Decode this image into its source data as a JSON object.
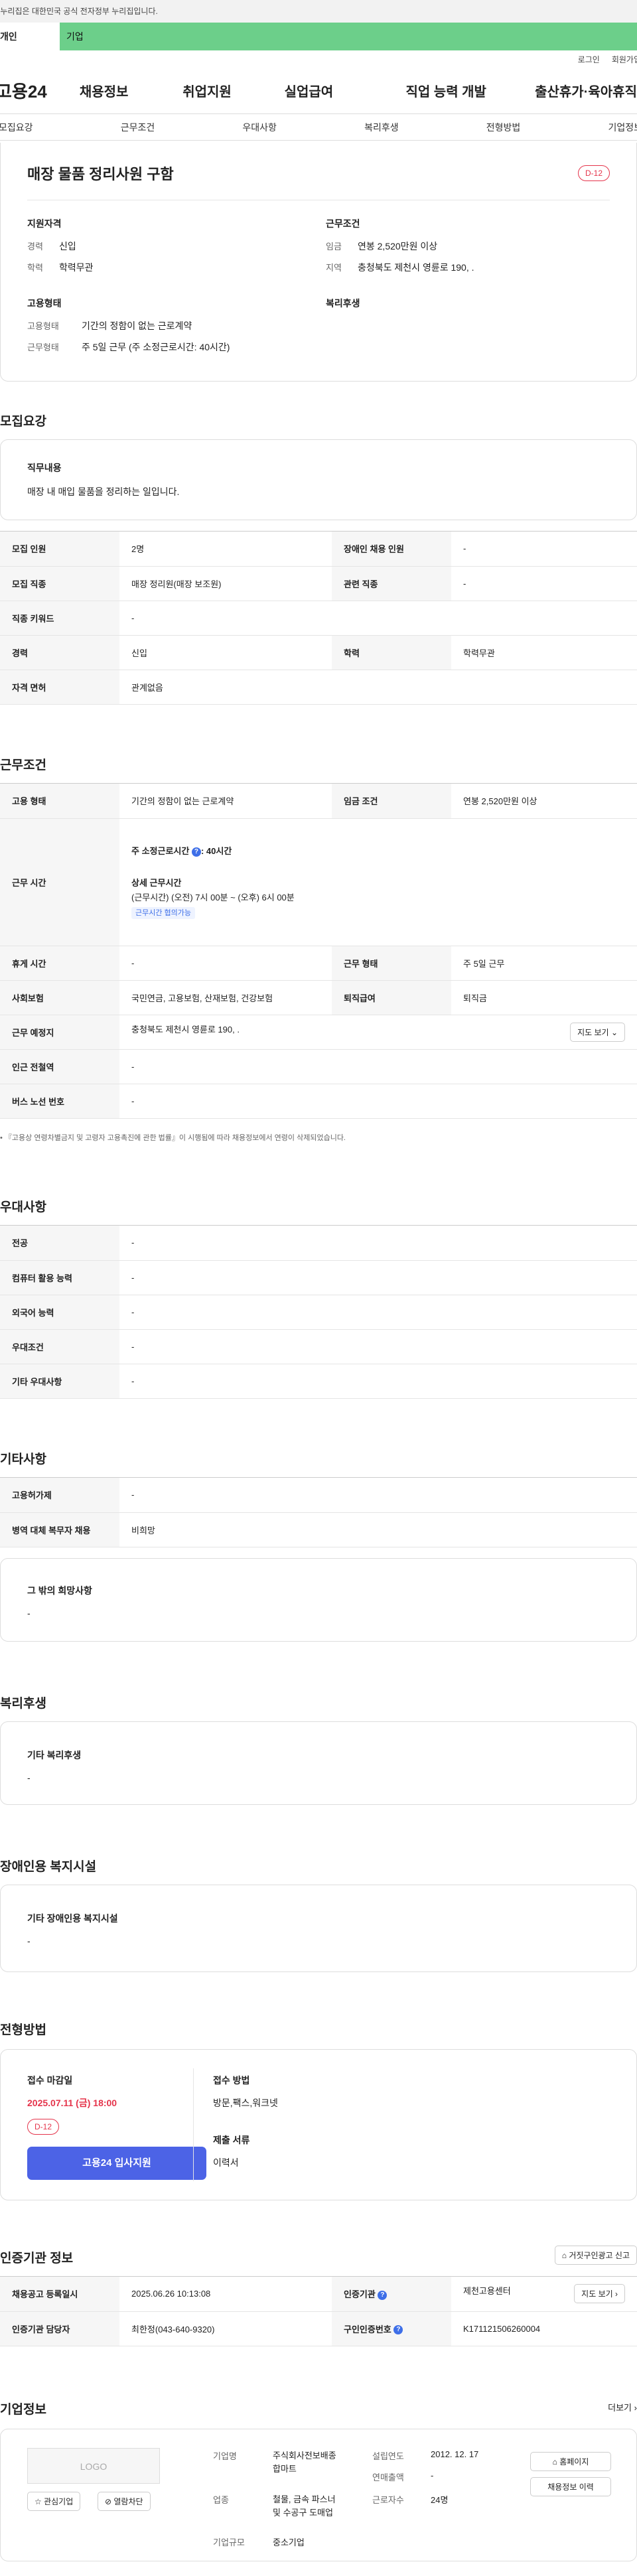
{
  "gov_banner": "이 누리집은 대한민국 공식 전자정부 누리집입니다.",
  "top_tabs": [
    "개인",
    "기업"
  ],
  "util": [
    "로그인",
    "회원가입"
  ],
  "logo": "고용24",
  "gnb": [
    "채용정보",
    "취업지원",
    "실업급여",
    "직업 능력 개발",
    "출산휴가·육아휴직"
  ],
  "subnav": [
    "모집요강",
    "근무조건",
    "우대사항",
    "복리후생",
    "전형방법",
    "기업정보"
  ],
  "summary": {
    "title": "매장 물품 정리사원 구함",
    "dday": "D-12",
    "qual_label": "지원자격",
    "cond_label": "근무조건",
    "career_k": "경력",
    "career_v": "신입",
    "edu_k": "학력",
    "edu_v": "학력무관",
    "wage_k": "임금",
    "wage_v": "연봉 2,520만원 이상",
    "region_k": "지역",
    "region_v": "충청북도 제천시 영륜로 190, .",
    "emp_label": "고용형태",
    "welfare_label": "복리후생",
    "empform_k": "고용형태",
    "empform_v": "기간의 정함이 없는 근로계약",
    "worktype_k": "근무형태",
    "worktype_v": "주 5일 근무 (주 소정근로시간: 40시간)"
  },
  "recruit": {
    "title": "모집요강",
    "job_label": "직무내용",
    "job_text": "매장 내 매입 물품을 정리하는 일입니다.",
    "rows": [
      [
        "모집 인원",
        "2명",
        "장애인 채용 인원",
        "-"
      ],
      [
        "모집 직종",
        "매장 정리원(매장 보조원)",
        "관련 직종",
        "-"
      ],
      [
        "직종 키워드",
        "-"
      ],
      [
        "경력",
        "신입",
        "학력",
        "학력무관"
      ],
      [
        "자격 면허",
        "관계없음"
      ]
    ]
  },
  "work": {
    "title": "근무조건",
    "emp_k": "고용 형태",
    "emp_v": "기간의 정함이 없는 근로계약",
    "wage_k": "임금 조건",
    "wage_v": "연봉 2,520만원 이상",
    "hours_k": "근무 시간",
    "hours_total": "주 소정근로시간",
    "hours_total_v": ": 40시간",
    "hours_detail_label": "상세 근무시간",
    "hours_detail": "(근무시간) (오전) 7시 00분 ~ (오후) 6시 00분",
    "hours_badge": "근무시간 협의가능",
    "rows": [
      [
        "휴게 시간",
        "-",
        "근무 형태",
        "주 5일 근무"
      ],
      [
        "사회보험",
        "국민연금, 고용보험, 산재보험, 건강보험",
        "퇴직급여",
        "퇴직금"
      ]
    ],
    "place_k": "근무 예정지",
    "place_v": "충청북도 제천시 영륜로 190, .",
    "map_btn": "지도 보기",
    "station_k": "인근 전철역",
    "station_v": "-",
    "bus_k": "버스 노선 번호",
    "bus_v": "-",
    "note": "『고용상 연령차별금지 및 고령자 고용촉진에 관한 법률』이 시행됨에 따라 채용정보에서 연령이 삭제되었습니다."
  },
  "pref": {
    "title": "우대사항",
    "rows": [
      [
        "전공",
        "-"
      ],
      [
        "컴퓨터 활용 능력",
        "-"
      ],
      [
        "외국어 능력",
        "-"
      ],
      [
        "우대조건",
        "-"
      ],
      [
        "기타 우대사항",
        "-"
      ]
    ]
  },
  "etc": {
    "title": "기타사항",
    "rows": [
      [
        "고용허가제",
        "-"
      ],
      [
        "병역 대체 복무자 채용",
        "비희망"
      ]
    ],
    "other_label": "그 밖의 희망사항",
    "other_v": "-"
  },
  "welfare": {
    "title": "복리후생",
    "label": "기타 복리후생",
    "value": "-"
  },
  "disabled": {
    "title": "장애인용 복지시설",
    "label": "기타 장애인용 복지시설",
    "value": "-"
  },
  "select": {
    "title": "전형방법",
    "deadline_label": "접수 마감일",
    "deadline": "2025.07.11 (금) 18:00",
    "dday": "D-12",
    "apply": "고용24 입사지원",
    "method_label": "접수 방법",
    "method": "방문,팩스,워크넷",
    "docs_label": "제출 서류",
    "docs": "이력서"
  },
  "cert": {
    "title": "인증기관 정보",
    "report_btn": "거짓구인광고 신고",
    "reg_k": "채용공고 등록일시",
    "reg_v": "2025.06.26 10:13:08",
    "org_k": "인증기관",
    "org_v": "제천고용센터",
    "map_btn": "지도 보기",
    "mgr_k": "인증기관 담당자",
    "mgr_v": "최한정(043-640-9320)",
    "no_k": "구인인증번호",
    "no_v": "K171121506260004"
  },
  "company": {
    "title": "기업정보",
    "more": "더보기",
    "logo_text": "LOGO",
    "fav_btn": "관심기업",
    "block_btn": "열람차단",
    "name_k": "기업명",
    "name_v1": "주식회사전보배종",
    "name_v2": "합마트",
    "ind_k": "업종",
    "ind_v1": "철물, 금속 파스너",
    "ind_v2": "및 수공구 도매업",
    "size_k": "기업규모",
    "size_v": "중소기업",
    "year_k": "설립연도",
    "year_v": "2012. 12. 17",
    "sales_k": "연매출액",
    "sales_v": "-",
    "staff_k": "근로자수",
    "staff_v": "24명",
    "home_btn": "홈페이지",
    "history_btn": "채용정보 이력"
  }
}
